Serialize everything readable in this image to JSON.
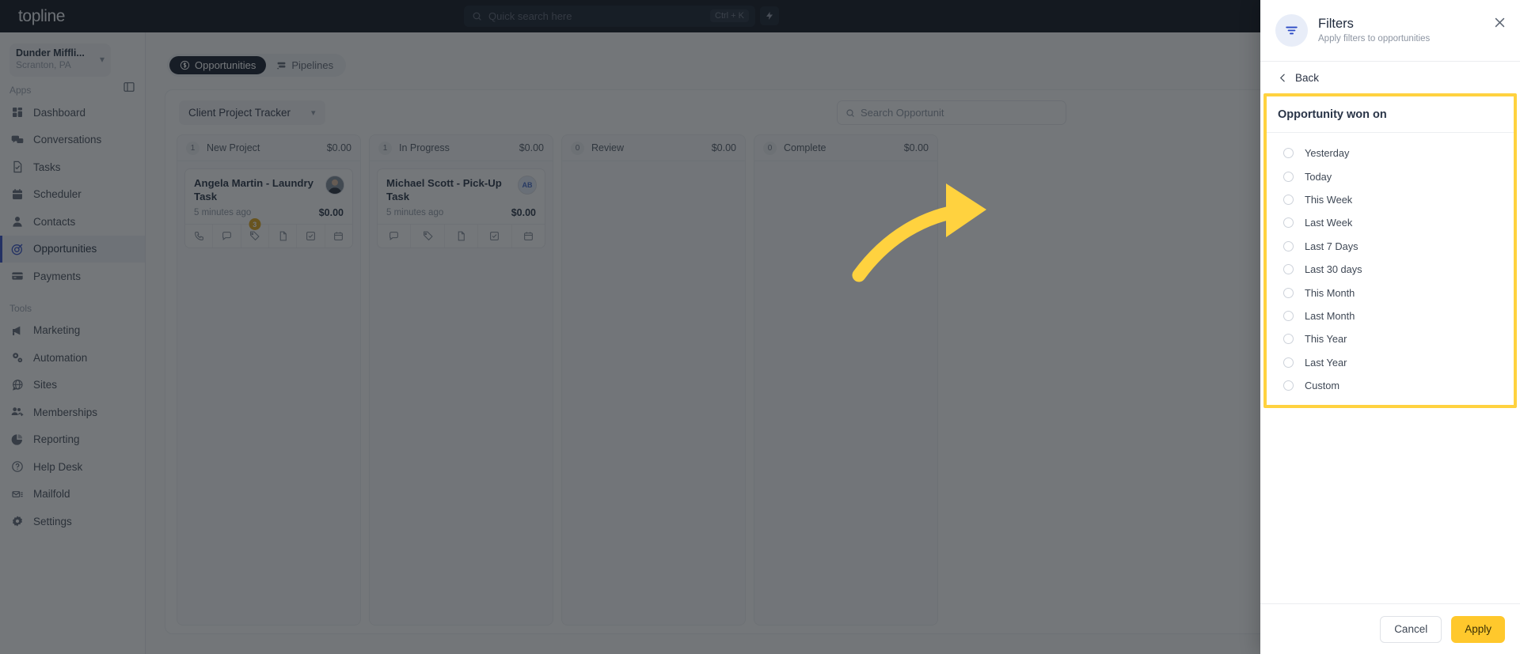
{
  "topbar": {
    "logo": "topline",
    "search_placeholder": "Quick search here",
    "search_value": "",
    "shortcut": "Ctrl + K",
    "bolt_icon": "lightning-bolt-icon",
    "search_icon": "search-icon"
  },
  "sidebar": {
    "location": {
      "name": "Dunder Miffli...",
      "sub": "Scranton, PA",
      "chevron": "chevron-down-icon"
    },
    "panel_toggle_icon": "panel-toggle-icon",
    "groups": [
      {
        "label": "Apps",
        "items": [
          {
            "label": "Dashboard",
            "icon": "dashboard-icon",
            "active": false
          },
          {
            "label": "Conversations",
            "icon": "chat-bubbles-icon",
            "active": false
          },
          {
            "label": "Tasks",
            "icon": "task-document-icon",
            "active": false
          },
          {
            "label": "Scheduler",
            "icon": "calendar-icon",
            "active": false
          },
          {
            "label": "Contacts",
            "icon": "person-icon",
            "active": false
          },
          {
            "label": "Opportunities",
            "icon": "target-icon",
            "active": true
          },
          {
            "label": "Payments",
            "icon": "credit-card-icon",
            "active": false
          }
        ]
      },
      {
        "label": "Tools",
        "items": [
          {
            "label": "Marketing",
            "icon": "megaphone-icon",
            "active": false
          },
          {
            "label": "Automation",
            "icon": "gears-icon",
            "active": false
          },
          {
            "label": "Sites",
            "icon": "globe-icon",
            "active": false
          },
          {
            "label": "Memberships",
            "icon": "people-plus-icon",
            "active": false
          },
          {
            "label": "Reporting",
            "icon": "pie-chart-icon",
            "active": false
          },
          {
            "label": "Help Desk",
            "icon": "question-circle-icon",
            "active": false
          },
          {
            "label": "Mailfold",
            "icon": "mail-stack-icon",
            "active": false
          },
          {
            "label": "Settings",
            "icon": "gear-icon",
            "active": false
          }
        ]
      }
    ]
  },
  "main": {
    "tabs": [
      {
        "label": "Opportunities",
        "icon": "dollar-circle-icon",
        "active": true
      },
      {
        "label": "Pipelines",
        "icon": "pipeline-icon",
        "active": false
      }
    ],
    "pipeline_selector": {
      "label": "Client Project Tracker",
      "chevron": "chevron-down-icon"
    },
    "board_search": {
      "placeholder": "Search Opportunit",
      "value": "",
      "icon": "search-icon"
    },
    "columns": [
      {
        "count": "1",
        "title": "New Project",
        "amount": "$0.00",
        "cards": [
          {
            "title": "Angela Martin - Laundry Task",
            "time": "5 minutes ago",
            "amount": "$0.00",
            "avatar_type": "photo",
            "avatar_initials": "",
            "actions": [
              {
                "icon": "phone-call-icon",
                "badge": ""
              },
              {
                "icon": "sms-bubble-icon",
                "badge": ""
              },
              {
                "icon": "tag-icon",
                "badge": "3"
              },
              {
                "icon": "document-icon",
                "badge": ""
              },
              {
                "icon": "checkbox-task-icon",
                "badge": ""
              },
              {
                "icon": "calendar-icon",
                "badge": ""
              }
            ]
          }
        ]
      },
      {
        "count": "1",
        "title": "In Progress",
        "amount": "$0.00",
        "cards": [
          {
            "title": "Michael Scott - Pick-Up Task",
            "time": "5 minutes ago",
            "amount": "$0.00",
            "avatar_type": "initials",
            "avatar_initials": "AB",
            "actions": [
              {
                "icon": "sms-bubble-icon",
                "badge": ""
              },
              {
                "icon": "tag-icon",
                "badge": ""
              },
              {
                "icon": "document-icon",
                "badge": ""
              },
              {
                "icon": "checkbox-task-icon",
                "badge": ""
              },
              {
                "icon": "calendar-icon",
                "badge": ""
              }
            ]
          }
        ]
      },
      {
        "count": "0",
        "title": "Review",
        "amount": "$0.00",
        "cards": []
      },
      {
        "count": "0",
        "title": "Complete",
        "amount": "$0.00",
        "cards": []
      }
    ]
  },
  "drawer": {
    "icon": "filter-icon",
    "title": "Filters",
    "subtitle": "Apply filters to opportunities",
    "close_icon": "close-icon",
    "back": {
      "label": "Back",
      "icon": "chevron-left-icon"
    },
    "group_title": "Opportunity won on",
    "options": [
      {
        "label": "Yesterday",
        "selected": false
      },
      {
        "label": "Today",
        "selected": false
      },
      {
        "label": "This Week",
        "selected": false
      },
      {
        "label": "Last Week",
        "selected": false
      },
      {
        "label": "Last 7 Days",
        "selected": false
      },
      {
        "label": "Last 30 days",
        "selected": false
      },
      {
        "label": "This Month",
        "selected": false
      },
      {
        "label": "Last Month",
        "selected": false
      },
      {
        "label": "This Year",
        "selected": false
      },
      {
        "label": "Last Year",
        "selected": false
      },
      {
        "label": "Custom",
        "selected": false
      }
    ],
    "cancel_label": "Cancel",
    "apply_label": "Apply"
  },
  "annotation": {
    "arrow": "curved-arrow-pointing-right",
    "color": "#ffd23f"
  },
  "colors": {
    "accent_blue": "#2a49c5",
    "highlight_yellow": "#ffd23f",
    "apply_yellow": "#ffc82c",
    "topbar_dark": "#030913",
    "badge_amber": "#e0a411"
  }
}
